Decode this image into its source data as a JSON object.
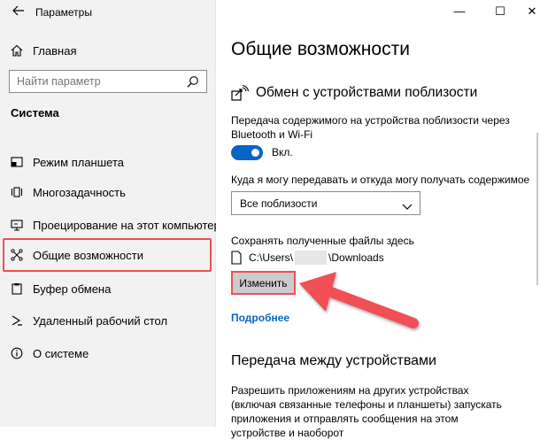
{
  "window": {
    "title": "Параметры",
    "back_icon": "arrow-left-icon",
    "minimize": "—",
    "maximize": "☐",
    "close": "✕"
  },
  "sidebar": {
    "home": "Главная",
    "search_placeholder": "Найти параметр",
    "section": "Система",
    "items": [
      {
        "label": "Режим планшета",
        "icon": "tablet-mode-icon"
      },
      {
        "label": "Многозадачность",
        "icon": "multitasking-icon"
      },
      {
        "label": "Проецирование на этот компьютер",
        "icon": "projecting-icon"
      },
      {
        "label": "Общие возможности",
        "icon": "shared-experiences-icon",
        "selected": true
      },
      {
        "label": "Буфер обмена",
        "icon": "clipboard-icon"
      },
      {
        "label": "Удаленный рабочий стол",
        "icon": "remote-desktop-icon"
      },
      {
        "label": "О системе",
        "icon": "info-icon"
      }
    ]
  },
  "main": {
    "title": "Общие возможности",
    "nearby_heading": "Обмен с устройствами поблизости",
    "nearby_desc": "Передача содержимого на устройства поблизости через Bluetooth и Wi-Fi",
    "toggle_label": "Вкл.",
    "toggle_on": true,
    "dropdown_label": "Куда я могу передавать и откуда могу получать содержимое",
    "dropdown_value": "Все поблизости",
    "save_label": "Сохранять полученные файлы здесь",
    "path_prefix": "C:\\Users\\",
    "path_suffix": "\\Downloads",
    "change_button": "Изменить",
    "more_link": "Подробнее",
    "cross_device_heading": "Передача между устройствами",
    "cross_device_desc": "Разрешить приложениям на других устройствах (включая связанные телефоны и планшеты) запускать приложения и отправлять сообщения на этом устройстве и наоборот"
  },
  "colors": {
    "accent": "#0a64c8",
    "highlight": "#ef4f55",
    "sidebar_bg": "#f2f2f2"
  }
}
